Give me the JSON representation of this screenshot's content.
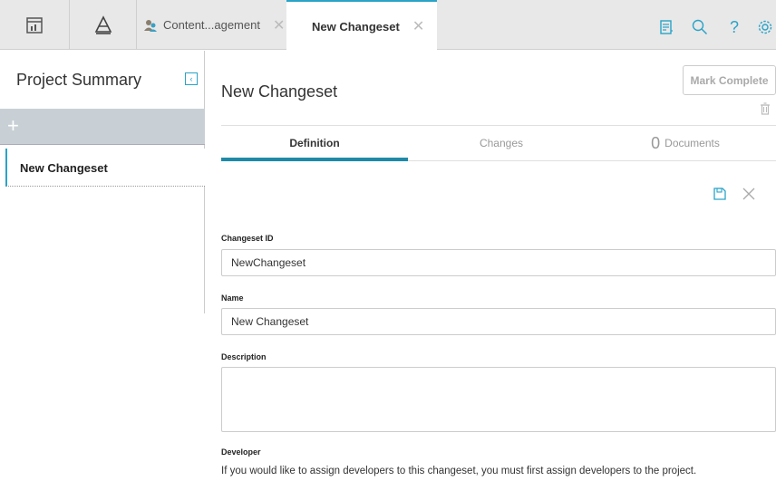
{
  "topbar": {
    "tabs": [
      {
        "label": "Content...agement",
        "close": "✕"
      },
      {
        "label": "New Changeset",
        "close": "✕"
      }
    ],
    "icons": [
      "dashboard-icon",
      "hierarchy-icon",
      "notes-icon",
      "search-icon",
      "help-icon",
      "settings-icon"
    ],
    "help_glyph": "?"
  },
  "sidebar": {
    "title": "Project Summary",
    "collapse_glyph": "‹",
    "add_glyph": "+",
    "items": [
      {
        "label": "New Changeset"
      }
    ]
  },
  "main": {
    "title": "New Changeset",
    "mark_complete_label": "Mark Complete",
    "tabs": [
      {
        "label": "Definition",
        "active": true
      },
      {
        "label": "Changes",
        "active": false
      },
      {
        "label": "Documents",
        "count": "0",
        "active": false
      }
    ],
    "form": {
      "changeset_id_label": "Changeset ID",
      "changeset_id_value": "NewChangeset",
      "name_label": "Name",
      "name_value": "New Changeset",
      "description_label": "Description",
      "description_value": "",
      "developer_label": "Developer",
      "developer_help": "If you would like to assign developers to this changeset, you must first assign developers to the project."
    }
  },
  "colors": {
    "accent": "#2aa3c7",
    "tab_underline": "#1f8aa8",
    "topbar_bg": "#e8e8e8",
    "add_row_bg": "#c8d0d6"
  }
}
